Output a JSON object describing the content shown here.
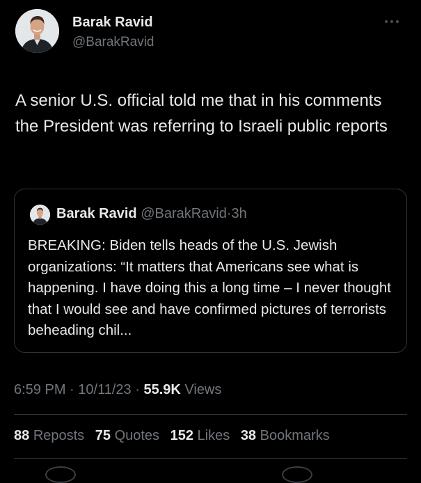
{
  "author": {
    "name": "Barak Ravid",
    "handle": "@BarakRavid"
  },
  "tweet": {
    "text": "A senior U.S. official told me that in his comments the President was referring to Israeli public reports"
  },
  "quote": {
    "name": "Barak Ravid",
    "handle": "@BarakRavid",
    "separator": "·",
    "age": "3h",
    "text": "BREAKING: Biden tells heads of the U.S. Jewish organizations: “It matters that Americans see what is happening. I have doing this a long time – I never thought that I would see and have confirmed pictures of terrorists beheading chil..."
  },
  "meta": {
    "time": "6:59 PM",
    "date": "10/11/23",
    "separator": "·",
    "views_count": "55.9K",
    "views_label": "Views"
  },
  "stats": {
    "reposts_count": "88",
    "reposts_label": "Reposts",
    "quotes_count": "75",
    "quotes_label": "Quotes",
    "likes_count": "152",
    "likes_label": "Likes",
    "bookmarks_count": "38",
    "bookmarks_label": "Bookmarks"
  },
  "icons": {
    "more": "more-options-icon"
  },
  "colors": {
    "background": "#000000",
    "text": "#e7e9ea",
    "secondary": "#71767b",
    "border": "#2f3336"
  }
}
